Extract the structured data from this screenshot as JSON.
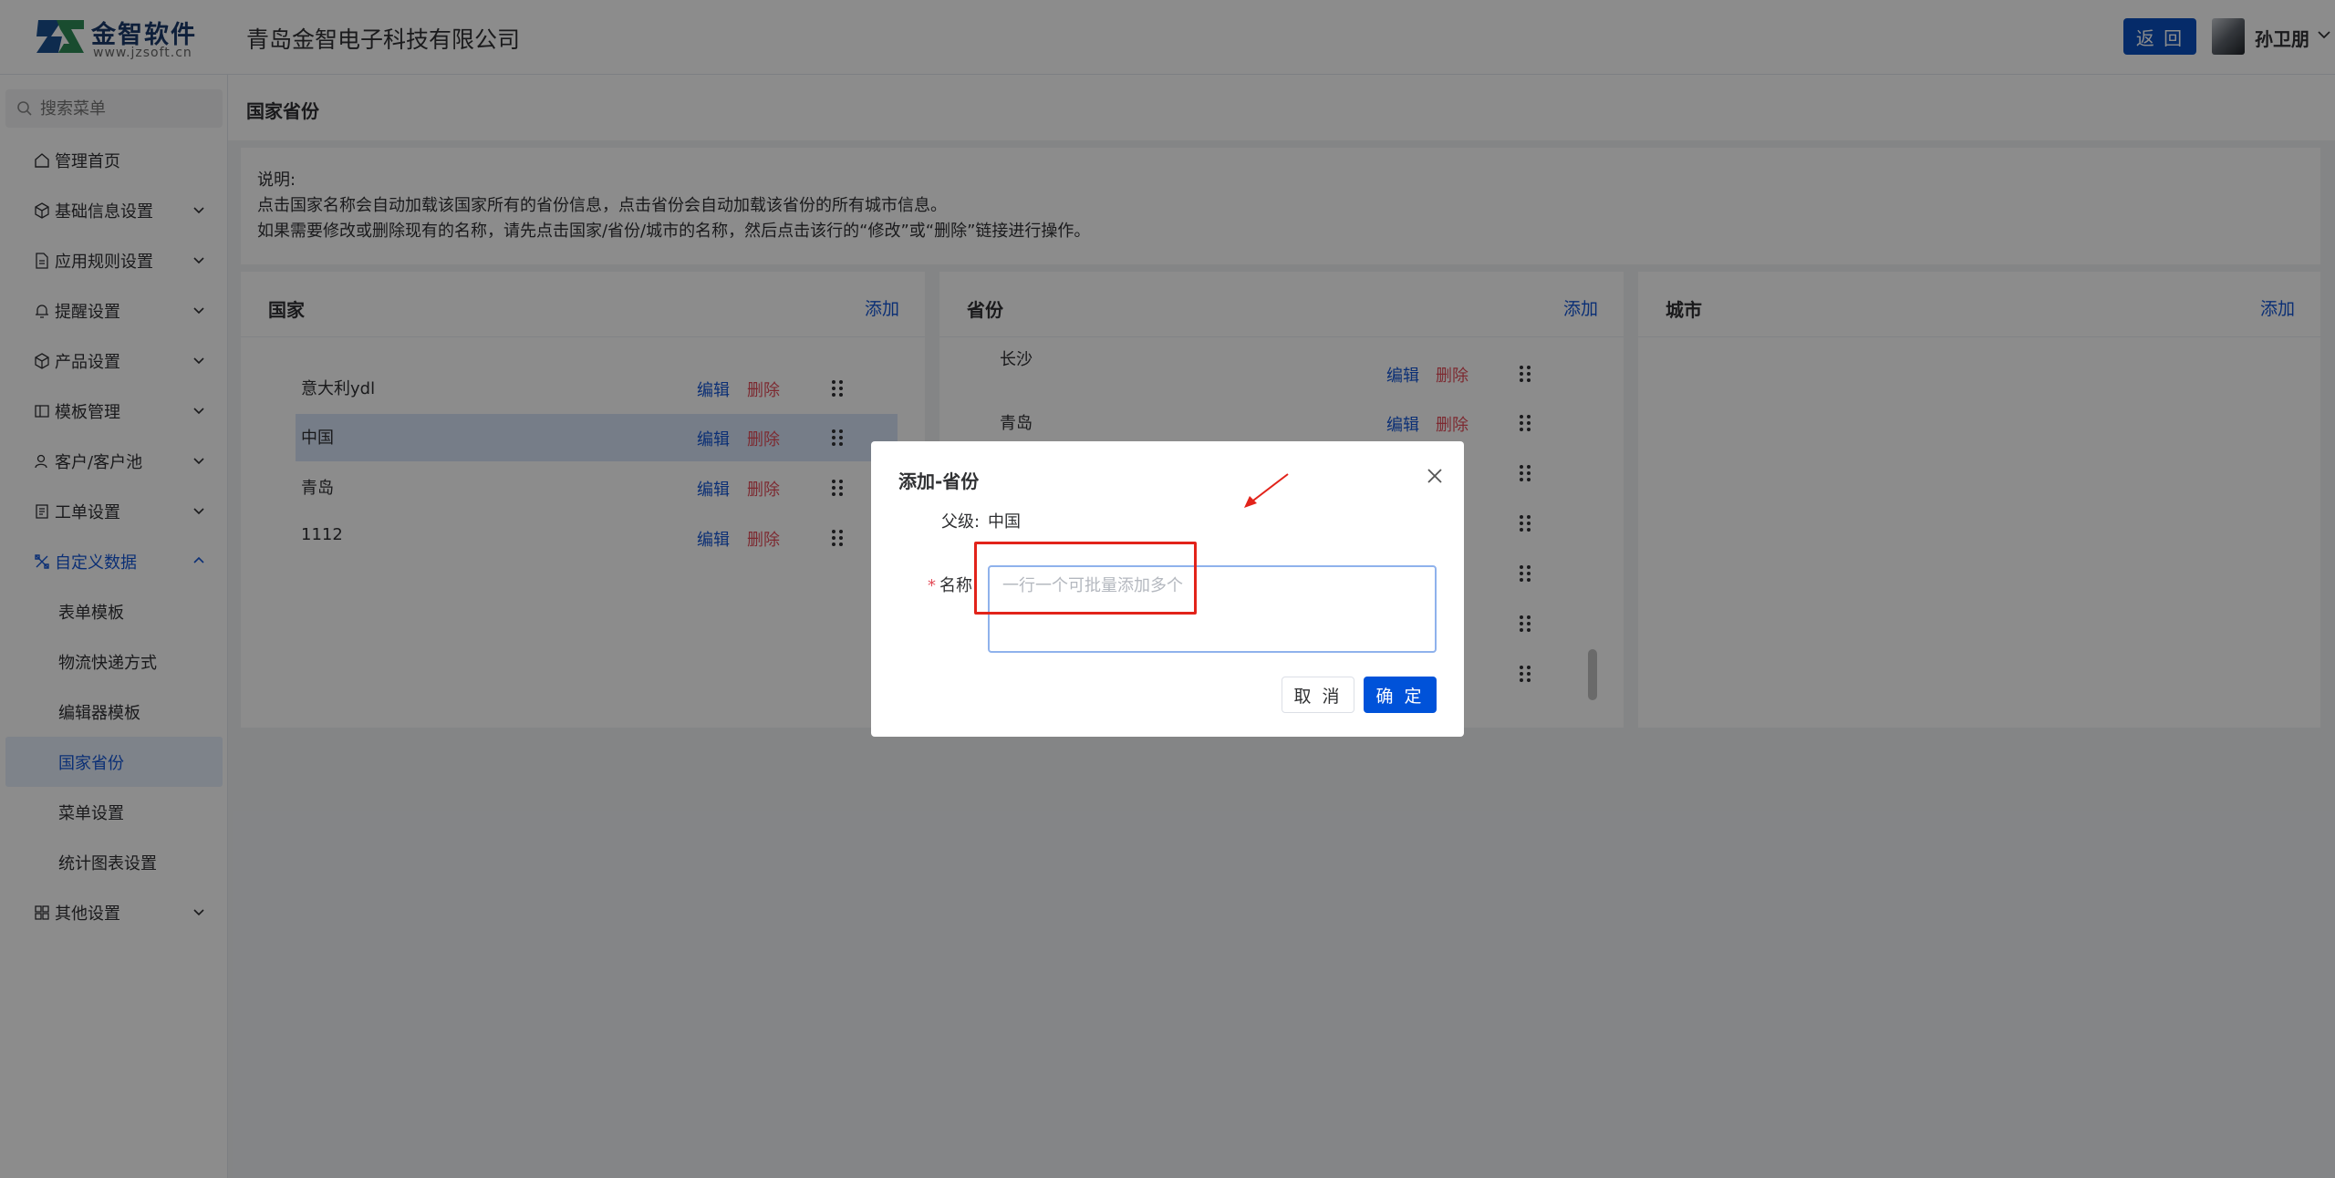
{
  "header": {
    "logo_title": "金智软件",
    "logo_sub": "www.jzsoft.cn",
    "company": "青岛金智电子科技有限公司",
    "back_label": "返 回",
    "username": "孙卫朋"
  },
  "sidebar": {
    "search_placeholder": "搜索菜单",
    "items": [
      {
        "label": "管理首页",
        "icon": "home-icon"
      },
      {
        "label": "基础信息设置",
        "icon": "box-icon"
      },
      {
        "label": "应用规则设置",
        "icon": "document-icon"
      },
      {
        "label": "提醒设置",
        "icon": "bell-icon"
      },
      {
        "label": "产品设置",
        "icon": "cube-icon"
      },
      {
        "label": "模板管理",
        "icon": "layout-icon"
      },
      {
        "label": "客户/客户池",
        "icon": "user-icon"
      },
      {
        "label": "工单设置",
        "icon": "ticket-icon"
      },
      {
        "label": "自定义数据",
        "icon": "tools-icon"
      },
      {
        "label": "其他设置",
        "icon": "grid-icon"
      }
    ],
    "sub_items": [
      "表单模板",
      "物流快递方式",
      "编辑器模板",
      "国家省份",
      "菜单设置",
      "统计图表设置"
    ],
    "active_sub": "国家省份"
  },
  "page": {
    "title": "国家省份",
    "notice_lines": [
      "说明:",
      "点击国家名称会自动加载该国家所有的省份信息，点击省份会自动加载该省份的所有城市信息。",
      "如果需要修改或删除现有的名称，请先点击国家/省份/城市的名称，然后点击该行的“修改”或“删除”链接进行操作。"
    ]
  },
  "panels": {
    "add_label": "添加",
    "edit_label": "编辑",
    "delete_label": "删除",
    "country": {
      "title": "国家",
      "rows": [
        "意大利ydl",
        "中国",
        "青岛",
        "1112"
      ],
      "selected": "中国"
    },
    "province": {
      "title": "省份",
      "rows": [
        "长沙",
        "青岛"
      ]
    },
    "city": {
      "title": "城市"
    }
  },
  "dialog": {
    "title": "添加-省份",
    "parent_label": "父级:",
    "parent_value": "中国",
    "name_label": "名称",
    "name_placeholder": "一行一个可批量添加多个",
    "name_value": "",
    "cancel_label": "取 消",
    "ok_label": "确 定"
  },
  "colors": {
    "primary": "#0052d9",
    "link": "#1456d6",
    "danger": "#e34d59",
    "annotation": "#e2231a"
  }
}
